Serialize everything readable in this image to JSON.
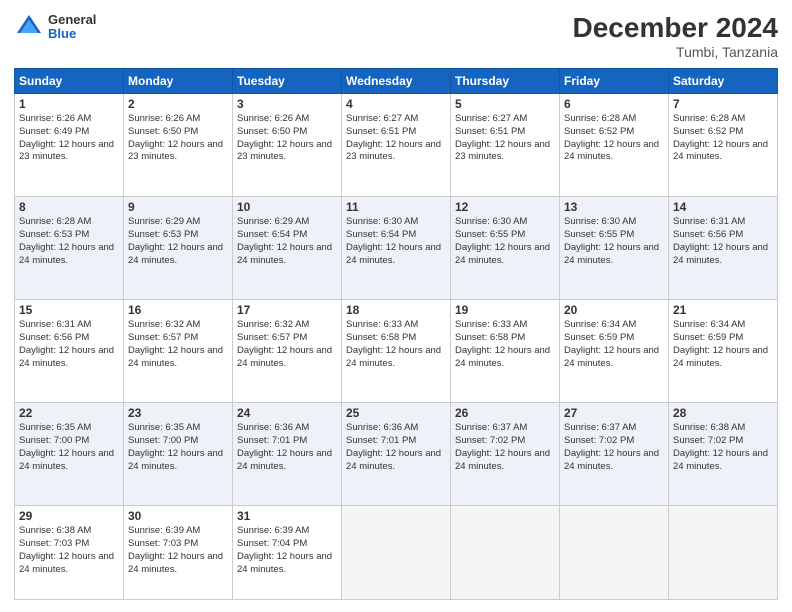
{
  "logo": {
    "general": "General",
    "blue": "Blue"
  },
  "title": "December 2024",
  "location": "Tumbi, Tanzania",
  "days_of_week": [
    "Sunday",
    "Monday",
    "Tuesday",
    "Wednesday",
    "Thursday",
    "Friday",
    "Saturday"
  ],
  "weeks": [
    [
      {
        "day": "1",
        "sunrise": "6:26 AM",
        "sunset": "6:49 PM",
        "daylight": "12 hours and 23 minutes."
      },
      {
        "day": "2",
        "sunrise": "6:26 AM",
        "sunset": "6:50 PM",
        "daylight": "12 hours and 23 minutes."
      },
      {
        "day": "3",
        "sunrise": "6:26 AM",
        "sunset": "6:50 PM",
        "daylight": "12 hours and 23 minutes."
      },
      {
        "day": "4",
        "sunrise": "6:27 AM",
        "sunset": "6:51 PM",
        "daylight": "12 hours and 23 minutes."
      },
      {
        "day": "5",
        "sunrise": "6:27 AM",
        "sunset": "6:51 PM",
        "daylight": "12 hours and 23 minutes."
      },
      {
        "day": "6",
        "sunrise": "6:28 AM",
        "sunset": "6:52 PM",
        "daylight": "12 hours and 24 minutes."
      },
      {
        "day": "7",
        "sunrise": "6:28 AM",
        "sunset": "6:52 PM",
        "daylight": "12 hours and 24 minutes."
      }
    ],
    [
      {
        "day": "8",
        "sunrise": "6:28 AM",
        "sunset": "6:53 PM",
        "daylight": "12 hours and 24 minutes."
      },
      {
        "day": "9",
        "sunrise": "6:29 AM",
        "sunset": "6:53 PM",
        "daylight": "12 hours and 24 minutes."
      },
      {
        "day": "10",
        "sunrise": "6:29 AM",
        "sunset": "6:54 PM",
        "daylight": "12 hours and 24 minutes."
      },
      {
        "day": "11",
        "sunrise": "6:30 AM",
        "sunset": "6:54 PM",
        "daylight": "12 hours and 24 minutes."
      },
      {
        "day": "12",
        "sunrise": "6:30 AM",
        "sunset": "6:55 PM",
        "daylight": "12 hours and 24 minutes."
      },
      {
        "day": "13",
        "sunrise": "6:30 AM",
        "sunset": "6:55 PM",
        "daylight": "12 hours and 24 minutes."
      },
      {
        "day": "14",
        "sunrise": "6:31 AM",
        "sunset": "6:56 PM",
        "daylight": "12 hours and 24 minutes."
      }
    ],
    [
      {
        "day": "15",
        "sunrise": "6:31 AM",
        "sunset": "6:56 PM",
        "daylight": "12 hours and 24 minutes."
      },
      {
        "day": "16",
        "sunrise": "6:32 AM",
        "sunset": "6:57 PM",
        "daylight": "12 hours and 24 minutes."
      },
      {
        "day": "17",
        "sunrise": "6:32 AM",
        "sunset": "6:57 PM",
        "daylight": "12 hours and 24 minutes."
      },
      {
        "day": "18",
        "sunrise": "6:33 AM",
        "sunset": "6:58 PM",
        "daylight": "12 hours and 24 minutes."
      },
      {
        "day": "19",
        "sunrise": "6:33 AM",
        "sunset": "6:58 PM",
        "daylight": "12 hours and 24 minutes."
      },
      {
        "day": "20",
        "sunrise": "6:34 AM",
        "sunset": "6:59 PM",
        "daylight": "12 hours and 24 minutes."
      },
      {
        "day": "21",
        "sunrise": "6:34 AM",
        "sunset": "6:59 PM",
        "daylight": "12 hours and 24 minutes."
      }
    ],
    [
      {
        "day": "22",
        "sunrise": "6:35 AM",
        "sunset": "7:00 PM",
        "daylight": "12 hours and 24 minutes."
      },
      {
        "day": "23",
        "sunrise": "6:35 AM",
        "sunset": "7:00 PM",
        "daylight": "12 hours and 24 minutes."
      },
      {
        "day": "24",
        "sunrise": "6:36 AM",
        "sunset": "7:01 PM",
        "daylight": "12 hours and 24 minutes."
      },
      {
        "day": "25",
        "sunrise": "6:36 AM",
        "sunset": "7:01 PM",
        "daylight": "12 hours and 24 minutes."
      },
      {
        "day": "26",
        "sunrise": "6:37 AM",
        "sunset": "7:02 PM",
        "daylight": "12 hours and 24 minutes."
      },
      {
        "day": "27",
        "sunrise": "6:37 AM",
        "sunset": "7:02 PM",
        "daylight": "12 hours and 24 minutes."
      },
      {
        "day": "28",
        "sunrise": "6:38 AM",
        "sunset": "7:02 PM",
        "daylight": "12 hours and 24 minutes."
      }
    ],
    [
      {
        "day": "29",
        "sunrise": "6:38 AM",
        "sunset": "7:03 PM",
        "daylight": "12 hours and 24 minutes."
      },
      {
        "day": "30",
        "sunrise": "6:39 AM",
        "sunset": "7:03 PM",
        "daylight": "12 hours and 24 minutes."
      },
      {
        "day": "31",
        "sunrise": "6:39 AM",
        "sunset": "7:04 PM",
        "daylight": "12 hours and 24 minutes."
      },
      null,
      null,
      null,
      null
    ]
  ]
}
